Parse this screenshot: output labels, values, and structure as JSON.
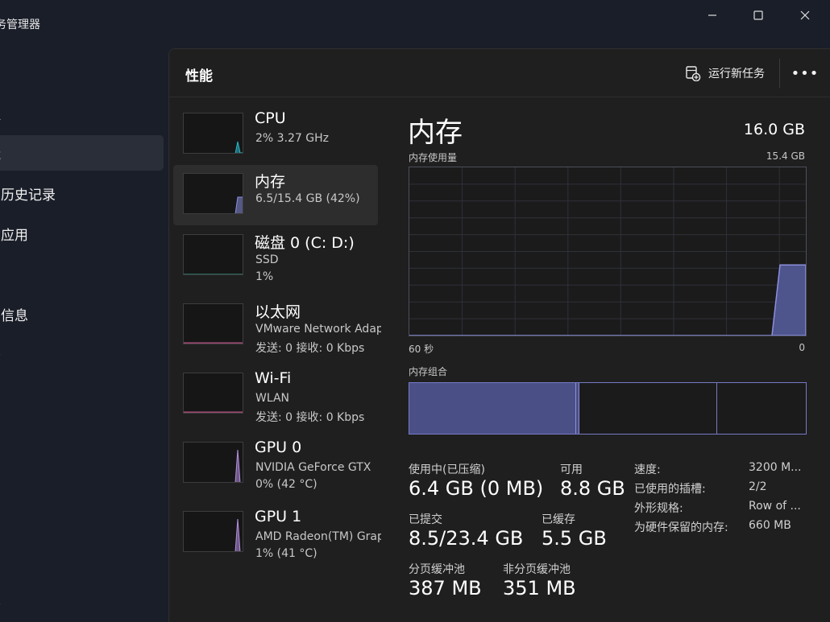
{
  "window": {
    "title": "务管理器"
  },
  "nav": {
    "items": [
      {
        "label": "程",
        "icon": "apps-icon"
      },
      {
        "label": "能",
        "icon": "performance-icon",
        "active": true
      },
      {
        "label": "用历史记录",
        "icon": "history-icon"
      },
      {
        "label": "动应用",
        "icon": "startup-icon"
      },
      {
        "label": "户",
        "icon": "users-icon"
      },
      {
        "label": "细信息",
        "icon": "details-icon"
      },
      {
        "label": "务",
        "icon": "services-icon"
      }
    ],
    "settings_label": "置"
  },
  "header": {
    "title": "性能",
    "run_task_label": "运行新任务",
    "more_label": "•••"
  },
  "resources": [
    {
      "name": "CPU",
      "line1": "2%  3.27 GHz",
      "line2": ""
    },
    {
      "name": "内存",
      "line1": "6.5/15.4 GB (42%)",
      "line2": "",
      "selected": true
    },
    {
      "name": "磁盘 0 (C: D:)",
      "line1": "SSD",
      "line2": "1%"
    },
    {
      "name": "以太网",
      "line1": "VMware Network Adapter",
      "line2": "发送: 0  接收: 0 Kbps"
    },
    {
      "name": "Wi-Fi",
      "line1": "WLAN",
      "line2": "发送: 0  接收: 0 Kbps"
    },
    {
      "name": "GPU 0",
      "line1": "NVIDIA GeForce GTX",
      "line2": "0%  (42 °C)"
    },
    {
      "name": "GPU 1",
      "line1": "AMD Radeon(TM) Graphics",
      "line2": "1%  (41 °C)"
    }
  ],
  "memory": {
    "title": "内存",
    "total": "16.0 GB",
    "usage_label": "内存使用量",
    "usage_max": "15.4 GB",
    "time_left": "60 秒",
    "time_right": "0",
    "composition_label": "内存组合",
    "composition": {
      "used_fraction": 0.42,
      "modified_fraction": 0.008,
      "standby_end_fraction": 0.77
    },
    "usage_history_fraction": [
      0,
      0,
      0,
      0,
      0,
      0,
      0,
      0,
      0,
      0.42,
      0.42
    ],
    "stats": {
      "in_use_label": "使用中(已压缩)",
      "in_use_value": "6.4 GB (0 MB)",
      "available_label": "可用",
      "available_value": "8.8 GB",
      "committed_label": "已提交",
      "committed_value": "8.5/23.4 GB",
      "cached_label": "已缓存",
      "cached_value": "5.5 GB",
      "paged_label": "分页缓冲池",
      "paged_value": "387 MB",
      "nonpaged_label": "非分页缓冲池",
      "nonpaged_value": "351 MB"
    },
    "details": [
      {
        "label": "速度:",
        "value": "3200 M..."
      },
      {
        "label": "已使用的插槽:",
        "value": "2/2"
      },
      {
        "label": "外形规格:",
        "value": "Row of ..."
      },
      {
        "label": "为硬件保留的内存:",
        "value": "660 MB"
      }
    ]
  },
  "colors": {
    "memory_accent": "#8b8fe0",
    "cpu_accent": "#2bb5c8",
    "disk_accent": "#3ab0a0",
    "network_accent": "#c0588a",
    "gpu_accent": "#b48ee0"
  }
}
